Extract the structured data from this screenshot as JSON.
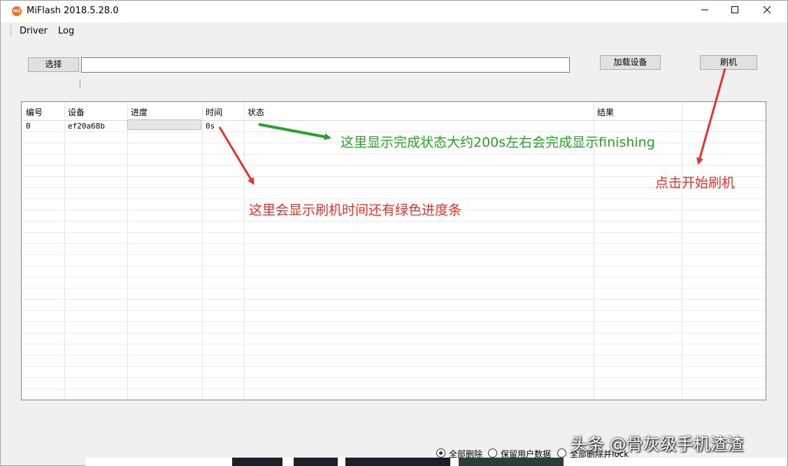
{
  "window": {
    "title": "MiFlash 2018.5.28.0",
    "icon_text": "mi",
    "brand_color": "#f26b1d"
  },
  "menu": {
    "items": [
      {
        "label": "Driver"
      },
      {
        "label": "Log"
      }
    ]
  },
  "toolbar": {
    "select_label": "选择",
    "path_value": "",
    "load_devices_label": "加载设备",
    "flash_label": "刷机"
  },
  "grid": {
    "columns": [
      "编号",
      "设备",
      "进度",
      "时间",
      "状态",
      "结果"
    ],
    "rows": [
      {
        "id": "0",
        "device": "ef20a68b",
        "progress": 0,
        "time": "0s",
        "status": "",
        "result": ""
      }
    ]
  },
  "annotations": {
    "status_note": "这里显示完成状态大约200s左右会完成显示finishing",
    "time_note": "这里会显示刷机时间还有绿色进度条",
    "flash_note": "点击开始刷机",
    "green_color": "#2aa12a",
    "red_color": "#e8312b"
  },
  "options": {
    "items": [
      {
        "label": "全部删除",
        "selected": true
      },
      {
        "label": "保留用户数据",
        "selected": false
      },
      {
        "label": "全部删除并lock",
        "selected": false
      }
    ]
  },
  "watermark": "头条 @骨灰级手机渣渣"
}
